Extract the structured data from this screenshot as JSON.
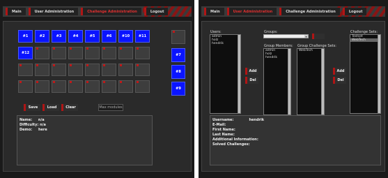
{
  "nav": {
    "main": "Main",
    "user_admin": "User Administration",
    "challenge_admin": "Challenge Administration",
    "logout": "Logout"
  },
  "grid": {
    "rows": [
      [
        "#1",
        "#2",
        "#3",
        "#4",
        "#5",
        "#6",
        "#10",
        "#11"
      ],
      [
        "#12",
        "",
        "",
        "",
        "",
        "",
        "",
        ""
      ],
      [
        "",
        "",
        "",
        "",
        "",
        "",
        "",
        ""
      ],
      [
        "",
        "",
        "",
        "",
        "",
        "",
        "",
        ""
      ]
    ],
    "active": [
      [
        true,
        true,
        true,
        true,
        true,
        true,
        true,
        true
      ],
      [
        true,
        false,
        false,
        false,
        false,
        false,
        false,
        false
      ],
      [
        false,
        false,
        false,
        false,
        false,
        false,
        false,
        false
      ],
      [
        false,
        false,
        false,
        false,
        false,
        false,
        false,
        false
      ]
    ],
    "side": [
      "",
      "#7",
      "#8",
      "#9"
    ],
    "side_active": [
      false,
      true,
      true,
      true
    ]
  },
  "buttons": {
    "save": "Save",
    "load": "Load",
    "clear": "Clear",
    "max_modules": "Max modules"
  },
  "details": {
    "name_label": "Name:",
    "name_value": "n/a",
    "difficulty_label": "Difficulty:",
    "difficulty_value": "n/a",
    "demo_label": "Demo:",
    "demo_value": "here"
  },
  "user_admin": {
    "users_label": "Users:",
    "users": [
      "admin",
      "holz",
      "hendrik"
    ],
    "groups_label": "Groups:",
    "group_members_label": "Group Members:",
    "group_members": [
      "admin",
      "holz",
      "hendrik"
    ],
    "group_challenge_sets_label": "Group Challenge Sets:",
    "group_challenge_sets": [
      "WebTech"
    ],
    "challenge_sets_label": "Challenge Sets:",
    "challenge_sets": [
      "Testset",
      "WebTech"
    ],
    "add": "Add",
    "del": "Del",
    "info": {
      "username_label": "Username:",
      "username_value": "hendrik",
      "email_label": "E-Mail:",
      "first_name_label": "First Name:",
      "last_name_label": "Last Name:",
      "additional_label": "Additional Information:",
      "solved_label": "Solved Challenges:"
    }
  },
  "colors": {
    "accent_red": "#b01515",
    "active_cell": "#0a14ff"
  }
}
